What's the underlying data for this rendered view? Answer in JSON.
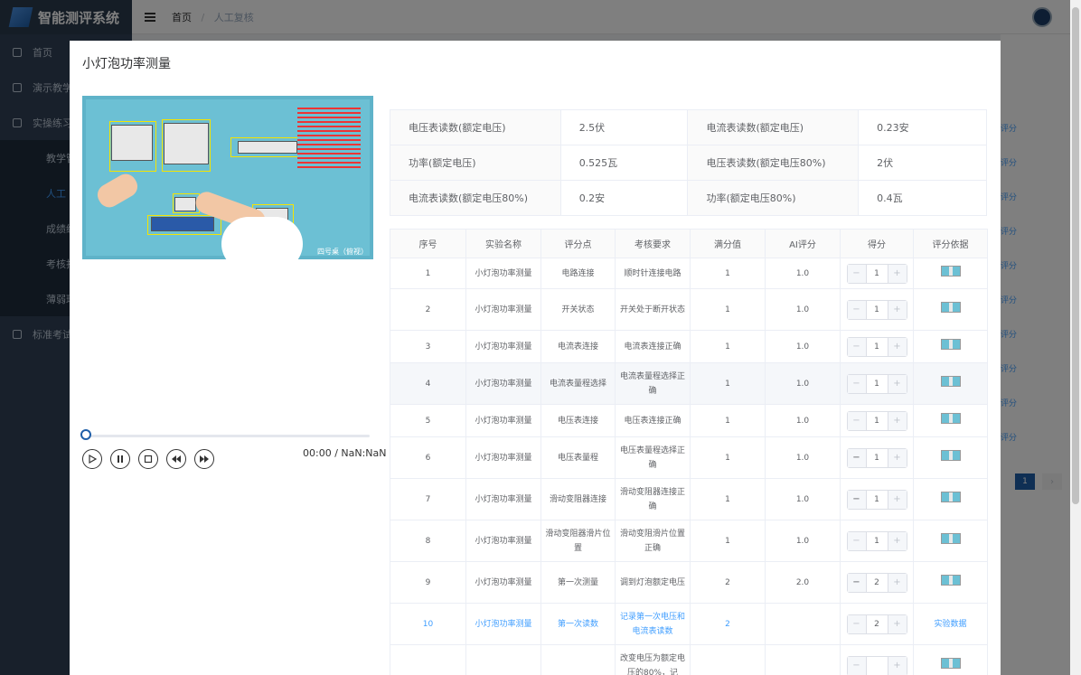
{
  "app": {
    "title": "智能测评系统"
  },
  "breadcrumb": {
    "home": "首页",
    "separator": "/",
    "current": "人工复核"
  },
  "sidebar": {
    "items": [
      {
        "label": "首页"
      },
      {
        "label": "演示教学"
      },
      {
        "label": "实操练习"
      },
      {
        "label": "标准考试"
      }
    ],
    "subitems": [
      {
        "label": "教学管"
      },
      {
        "label": "人工"
      },
      {
        "label": "成绩统"
      },
      {
        "label": "考核抄"
      },
      {
        "label": "薄弱环"
      }
    ]
  },
  "background_links": [
    "评分",
    "评分",
    "评分",
    "评分",
    "评分",
    "评分",
    "评分",
    "评分",
    "评分",
    "评分"
  ],
  "pagination": {
    "current": "1",
    "next": "›"
  },
  "dialog": {
    "title": "小灯泡功率测量",
    "video": {
      "caption": "四号桌（俯视）",
      "time": "00:00 / NaN:NaN",
      "progress": 0
    }
  },
  "info": [
    [
      "电压表读数(额定电压)",
      "2.5伏",
      "电流表读数(额定电压)",
      "0.23安"
    ],
    [
      "功率(额定电压)",
      "0.525瓦",
      "电压表读数(额定电压80%)",
      "2伏"
    ],
    [
      "电流表读数(额定电压80%)",
      "0.2安",
      "功率(额定电压80%)",
      "0.4瓦"
    ]
  ],
  "score_table": {
    "headers": [
      "序号",
      "实验名称",
      "评分点",
      "考核要求",
      "满分值",
      "AI评分",
      "得分",
      "评分依据"
    ],
    "rows": [
      {
        "no": "1",
        "name": "小灯泡功率测量",
        "point": "电路连接",
        "req": "顺时针连接电路",
        "full": "1",
        "ai": "1.0",
        "score": "1",
        "basis": "",
        "minus": "−",
        "plus": "+"
      },
      {
        "no": "2",
        "name": "小灯泡功率测量",
        "point": "开关状态",
        "req": "开关处于断开状态",
        "full": "1",
        "ai": "1.0",
        "score": "1",
        "basis": "",
        "minus": "−",
        "plus": "+"
      },
      {
        "no": "3",
        "name": "小灯泡功率测量",
        "point": "电流表连接",
        "req": "电流表连接正确",
        "full": "1",
        "ai": "1.0",
        "score": "1",
        "basis": "",
        "minus": "−",
        "plus": "+"
      },
      {
        "no": "4",
        "name": "小灯泡功率测量",
        "point": "电流表量程选择",
        "req": "电流表量程选择正确",
        "full": "1",
        "ai": "1.0",
        "score": "1",
        "basis": "",
        "minus": "−",
        "plus": "+"
      },
      {
        "no": "5",
        "name": "小灯泡功率测量",
        "point": "电压表连接",
        "req": "电压表连接正确",
        "full": "1",
        "ai": "1.0",
        "score": "1",
        "basis": "",
        "minus": "−",
        "plus": "+"
      },
      {
        "no": "6",
        "name": "小灯泡功率测量",
        "point": "电压表量程",
        "req": "电压表量程选择正确",
        "full": "1",
        "ai": "1.0",
        "score": "1",
        "basis": "",
        "minus": "−",
        "plus": "+"
      },
      {
        "no": "7",
        "name": "小灯泡功率测量",
        "point": "滑动变阻器连接",
        "req": "滑动变阻器连接正确",
        "full": "1",
        "ai": "1.0",
        "score": "1",
        "basis": "",
        "minus": "−",
        "plus": "+"
      },
      {
        "no": "8",
        "name": "小灯泡功率测量",
        "point": "滑动变阻器滑片位置",
        "req": "滑动变阻滑片位置正确",
        "full": "1",
        "ai": "1.0",
        "score": "1",
        "basis": "",
        "minus": "−",
        "plus": "+"
      },
      {
        "no": "9",
        "name": "小灯泡功率测量",
        "point": "第一次测量",
        "req": "调到灯泡额定电压",
        "full": "2",
        "ai": "2.0",
        "score": "2",
        "basis": "",
        "minus": "−",
        "plus": "+"
      },
      {
        "no": "10",
        "name": "小灯泡功率测量",
        "point": "第一次读数",
        "req": "记录第一次电压和电流表读数",
        "full": "2",
        "ai": "",
        "score": "2",
        "basis": "实验数据",
        "minus": "−",
        "plus": "+"
      },
      {
        "no": "",
        "name": "",
        "point": "",
        "req": "改变电压为额定电压的80%，记",
        "full": "",
        "ai": "",
        "score": "",
        "basis": "",
        "minus": "−",
        "plus": "+"
      }
    ]
  }
}
